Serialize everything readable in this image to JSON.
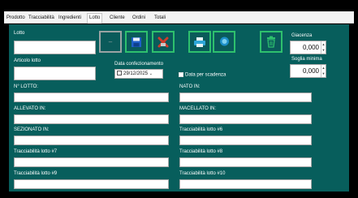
{
  "tabs": [
    "Prodotto",
    "Tracciabilità",
    "Ingredienti",
    "Lotto",
    "Cliente",
    "Ordini",
    "Totali"
  ],
  "active_tab": "Lotto",
  "form": {
    "lotto_label": "Lotto",
    "articolo_label": "Articolo lotto",
    "data_conf_label": "Data confezionamento",
    "data_conf_value": "29/12/2025",
    "per_scadenza_label": "Data per scadenza",
    "giacenza_label": "Giacenza",
    "giacenza_value": "0,000",
    "soglia_label": "Soglia minima",
    "soglia_value": "0,000",
    "n_lotto_label": "N° LOTTO:",
    "nato_label": "NATO IN:",
    "allevato_label": "ALLEVATO IN:",
    "macellato_label": "MACELLATO IN:",
    "sezionato_label": "SEZIONATO IN:",
    "tracc6_label": "Tracciabilità lotto #6",
    "tracc7_label": "Tracciabilità lotto #7",
    "tracc8_label": "Tracciabilità lotto #8",
    "tracc9_label": "Tracciabilità lotto #9",
    "tracc10_label": "Tracciabilità lotto #10"
  },
  "toolbar": {
    "buttons": [
      {
        "name": "blank-button",
        "icon": "blank-icon"
      },
      {
        "name": "save-button",
        "icon": "floppy-disk-icon"
      },
      {
        "name": "delete-button",
        "icon": "red-x-icon"
      },
      {
        "name": "print-button",
        "icon": "printer-icon"
      },
      {
        "name": "search-button",
        "icon": "search-icon"
      },
      {
        "name": "trash-button",
        "icon": "trash-icon"
      }
    ]
  },
  "colors": {
    "panel": "#075e5c",
    "button_border": "#2ec06d",
    "save_icon": "#1f5fc8",
    "delete_icon": "#d23b2b"
  }
}
